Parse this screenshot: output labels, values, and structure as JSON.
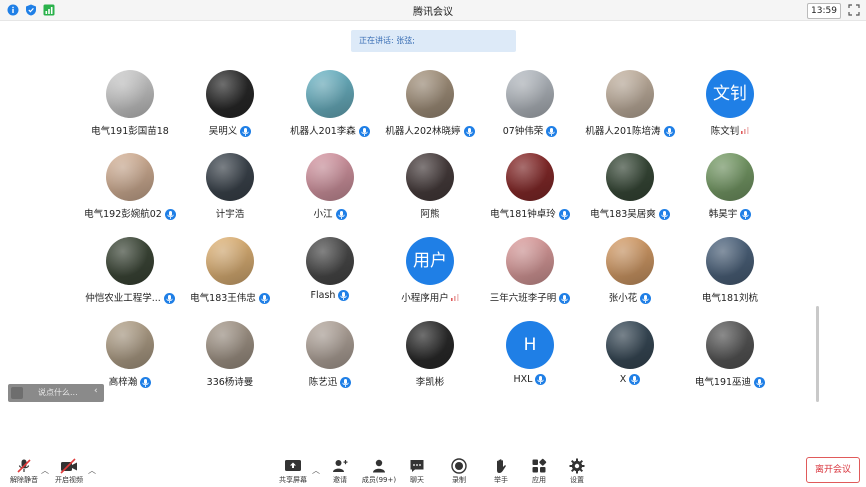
{
  "window": {
    "title": "腾讯会议",
    "time": "13:59"
  },
  "speaking_banner": "正在讲话: 张弦;",
  "participants": [
    {
      "name": "电气191彭国苗18",
      "mic": false,
      "avatar_color": "#cfcfcf",
      "avatar_text": ""
    },
    {
      "name": "吴明义",
      "mic": true,
      "avatar_color": "#2a2a2a",
      "avatar_text": ""
    },
    {
      "name": "机器人201李森",
      "mic": true,
      "avatar_color": "#6fb8c9",
      "avatar_text": ""
    },
    {
      "name": "机器人202林晓婷",
      "mic": true,
      "avatar_color": "#a89680",
      "avatar_text": ""
    },
    {
      "name": "07钟伟荣",
      "mic": true,
      "avatar_color": "#b9bfc6",
      "avatar_text": ""
    },
    {
      "name": "机器人201陈培涛",
      "mic": true,
      "avatar_color": "#c7b6a4",
      "avatar_text": ""
    },
    {
      "name": "陈文钊",
      "mic": false,
      "speaking": true,
      "avatar_color": "#1f7fe6",
      "avatar_text": "文钊"
    },
    {
      "name": "电气192彭婉航02",
      "mic": true,
      "avatar_color": "#d8b59a",
      "avatar_text": ""
    },
    {
      "name": "计宇浩",
      "mic": false,
      "avatar_color": "#3e4750",
      "avatar_text": ""
    },
    {
      "name": "小江",
      "mic": true,
      "avatar_color": "#d99aa6",
      "avatar_text": ""
    },
    {
      "name": "阿熊",
      "mic": false,
      "avatar_color": "#4a3f3f",
      "avatar_text": ""
    },
    {
      "name": "电气181钟卓玲",
      "mic": true,
      "avatar_color": "#8a2b2b",
      "avatar_text": ""
    },
    {
      "name": "电气183吴居爽",
      "mic": true,
      "avatar_color": "#3a4c3a",
      "avatar_text": ""
    },
    {
      "name": "韩昊宇",
      "mic": true,
      "avatar_color": "#7aa06a",
      "avatar_text": ""
    },
    {
      "name": "仲恺农业工程学...",
      "mic": true,
      "avatar_color": "#3f4a3a",
      "avatar_text": ""
    },
    {
      "name": "电气183王伟忠",
      "mic": true,
      "avatar_color": "#e4b77a",
      "avatar_text": ""
    },
    {
      "name": "Flash",
      "mic": true,
      "avatar_color": "#4c4c4c",
      "avatar_text": ""
    },
    {
      "name": "小程序用户",
      "mic": false,
      "speaking": true,
      "avatar_color": "#1f7fe6",
      "avatar_text": "用户"
    },
    {
      "name": "三年六班李子明",
      "mic": true,
      "avatar_color": "#e0a0a0",
      "avatar_text": ""
    },
    {
      "name": "张小花",
      "mic": true,
      "avatar_color": "#d9a06a",
      "avatar_text": ""
    },
    {
      "name": "电气181刘杭",
      "mic": false,
      "avatar_color": "#4f6680",
      "avatar_text": ""
    },
    {
      "name": "高梓瀚",
      "mic": true,
      "avatar_color": "#b5a48c",
      "avatar_text": ""
    },
    {
      "name": "336杨诗曼",
      "mic": false,
      "avatar_color": "#a79a8c",
      "avatar_text": ""
    },
    {
      "name": "陈艺迅",
      "mic": true,
      "avatar_color": "#b7aaa0",
      "avatar_text": ""
    },
    {
      "name": "李凯彬",
      "mic": false,
      "avatar_color": "#2c2c2c",
      "avatar_text": ""
    },
    {
      "name": "HXL",
      "mic": true,
      "avatar_color": "#1f7fe6",
      "avatar_text": "H"
    },
    {
      "name": "X",
      "mic": true,
      "avatar_color": "#3a4c5a",
      "avatar_text": ""
    },
    {
      "name": "电气191巫迪",
      "mic": true,
      "avatar_color": "#5a5a5a",
      "avatar_text": ""
    }
  ],
  "chat": {
    "placeholder": "说点什么..."
  },
  "toolbar": {
    "unmute": "解除静音",
    "start_video": "开启视频",
    "share_screen": "共享屏幕",
    "invite": "邀请",
    "members": "成员(99+)",
    "chat": "聊天",
    "record": "录制",
    "raise_hand": "举手",
    "apps": "应用",
    "settings": "设置",
    "leave": "离开会议"
  },
  "colors": {
    "accent": "#1f7fe6",
    "leave": "#d9363e",
    "banner_bg": "#ddeaf8"
  }
}
